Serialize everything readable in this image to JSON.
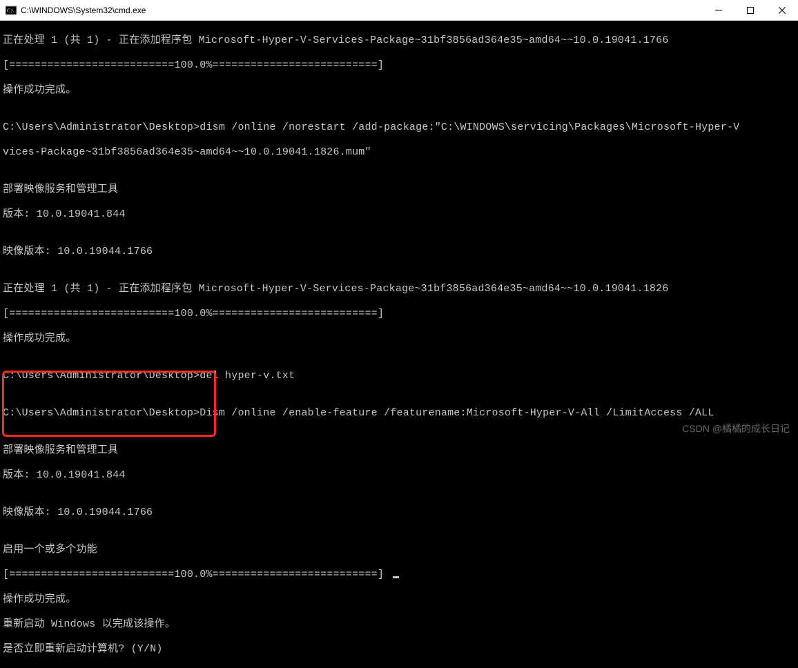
{
  "window": {
    "title": "C:\\WINDOWS\\System32\\cmd.exe"
  },
  "lines": {
    "l0": "正在处理 1 (共 1) - 正在添加程序包 Microsoft-Hyper-V-Services-Package~31bf3856ad364e35~amd64~~10.0.19041.1766",
    "l1": "[==========================100.0%==========================] ",
    "l2": "操作成功完成。",
    "l3": "",
    "l4": "C:\\Users\\Administrator\\Desktop>dism /online /norestart /add-package:\"C:\\WINDOWS\\servicing\\Packages\\Microsoft-Hyper-V",
    "l5": "vices-Package~31bf3856ad364e35~amd64~~10.0.19041.1826.mum\"",
    "l6": "",
    "l7": "部署映像服务和管理工具",
    "l8": "版本: 10.0.19041.844",
    "l9": "",
    "l10": "映像版本: 10.0.19044.1766",
    "l11": "",
    "l12": "正在处理 1 (共 1) - 正在添加程序包 Microsoft-Hyper-V-Services-Package~31bf3856ad364e35~amd64~~10.0.19041.1826",
    "l13": "[==========================100.0%==========================] ",
    "l14": "操作成功完成。",
    "l15": "",
    "l16": "C:\\Users\\Administrator\\Desktop>del hyper-v.txt",
    "l17": "",
    "l18": "C:\\Users\\Administrator\\Desktop>Dism /online /enable-feature /featurename:Microsoft-Hyper-V-All /LimitAccess /ALL",
    "l19": "",
    "l20": "部署映像服务和管理工具",
    "l21": "版本: 10.0.19041.844",
    "l22": "",
    "l23": "映像版本: 10.0.19044.1766",
    "l24": "",
    "l25": "启用一个或多个功能",
    "l26": "[==========================100.0%==========================] ",
    "l27": "操作成功完成。",
    "l28": "重新启动 Windows 以完成该操作。",
    "l29": "是否立即重新启动计算机? (Y/N)"
  },
  "watermark": "CSDN @橘橘的成长日记"
}
